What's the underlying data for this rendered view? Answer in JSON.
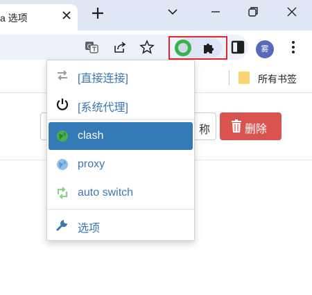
{
  "tab": {
    "title": "a 选项"
  },
  "bookmarks": {
    "all_bookmarks": "所有书签"
  },
  "profile": {
    "initial": "雾"
  },
  "page": {
    "rename_label": "称",
    "delete_label": "删除"
  },
  "popup": {
    "items": [
      {
        "label": "[直接连接]",
        "icon": "arrows-swap-icon"
      },
      {
        "label": "[系统代理]",
        "icon": "power-icon"
      },
      {
        "label": "clash",
        "icon": "globe-icon",
        "active": true
      },
      {
        "label": "proxy",
        "icon": "globe-icon"
      },
      {
        "label": "auto switch",
        "icon": "retweet-icon"
      },
      {
        "label": "选项",
        "icon": "wrench-icon"
      }
    ]
  },
  "colors": {
    "active_item_bg": "#337ab7",
    "link_text": "#3a77b0",
    "delete_button": "#d9534f",
    "highlight_box": "#e1262b",
    "proxy_icon": "#38b24a"
  }
}
